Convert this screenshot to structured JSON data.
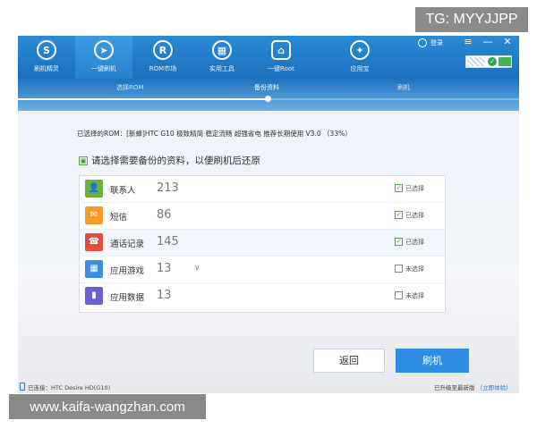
{
  "watermarks": {
    "top": "TG: MYYJJPP",
    "bottom": "www.kaifa-wangzhan.com"
  },
  "nav": [
    {
      "label": "刷机精灵",
      "icon": "shield-s-icon",
      "glyph": "S"
    },
    {
      "label": "一键刷机",
      "icon": "cursor-click-icon",
      "glyph": "➤"
    },
    {
      "label": "ROM市场",
      "icon": "rom-market-icon",
      "glyph": "R"
    },
    {
      "label": "实用工具",
      "icon": "toolbox-icon",
      "glyph": "▦"
    },
    {
      "label": "一键Root",
      "icon": "root-icon",
      "glyph": "⌂"
    },
    {
      "label": "应用宝",
      "icon": "app-store-icon",
      "glyph": "✦"
    }
  ],
  "header": {
    "login_label": "登录",
    "menu_glyph": "≡",
    "minimize_glyph": "—",
    "close_glyph": "✕"
  },
  "steps": [
    {
      "label": "选择ROM",
      "state": "done"
    },
    {
      "label": "备份资料",
      "state": "active"
    },
    {
      "label": "刷机",
      "state": "pending"
    }
  ],
  "rom_selected": "已选择的ROM：[新蜂]HTC G10 极致精简 稳定流畅 超强省电 推荐长期使用 V3.0 （33%）",
  "prompt": "请选择需要备份的资料，以便刷机后还原",
  "backup_items": [
    {
      "label": "联系人",
      "count": "213",
      "checked": true,
      "status": "已选择",
      "icon": "contact-icon",
      "glyph": "👤",
      "color": "#6ab23c"
    },
    {
      "label": "短信",
      "count": "86",
      "checked": true,
      "status": "已选择",
      "icon": "sms-icon",
      "glyph": "✉",
      "color": "#f39a2b"
    },
    {
      "label": "通话记录",
      "count": "145",
      "checked": true,
      "status": "已选择",
      "icon": "call-log-icon",
      "glyph": "☎",
      "color": "#e84b3c"
    },
    {
      "label": "应用游戏",
      "count": "13",
      "checked": false,
      "status": "未选择",
      "icon": "apps-games-icon",
      "glyph": "▦",
      "color": "#3c8ee0",
      "expandable": true
    },
    {
      "label": "应用数据",
      "count": "13",
      "checked": false,
      "status": "未选择",
      "icon": "app-data-icon",
      "glyph": "▮",
      "color": "#6a5fd1"
    }
  ],
  "buttons": {
    "back": "返回",
    "flash": "刷机"
  },
  "status": {
    "device": "已连接：HTC Desire HD(G10)",
    "update": "已升级至最新版",
    "update_link": "立即体验"
  },
  "colors": {
    "brand": "#1b70bd",
    "primary_button": "#2e8ce2",
    "checked": "#3a9a2e"
  }
}
